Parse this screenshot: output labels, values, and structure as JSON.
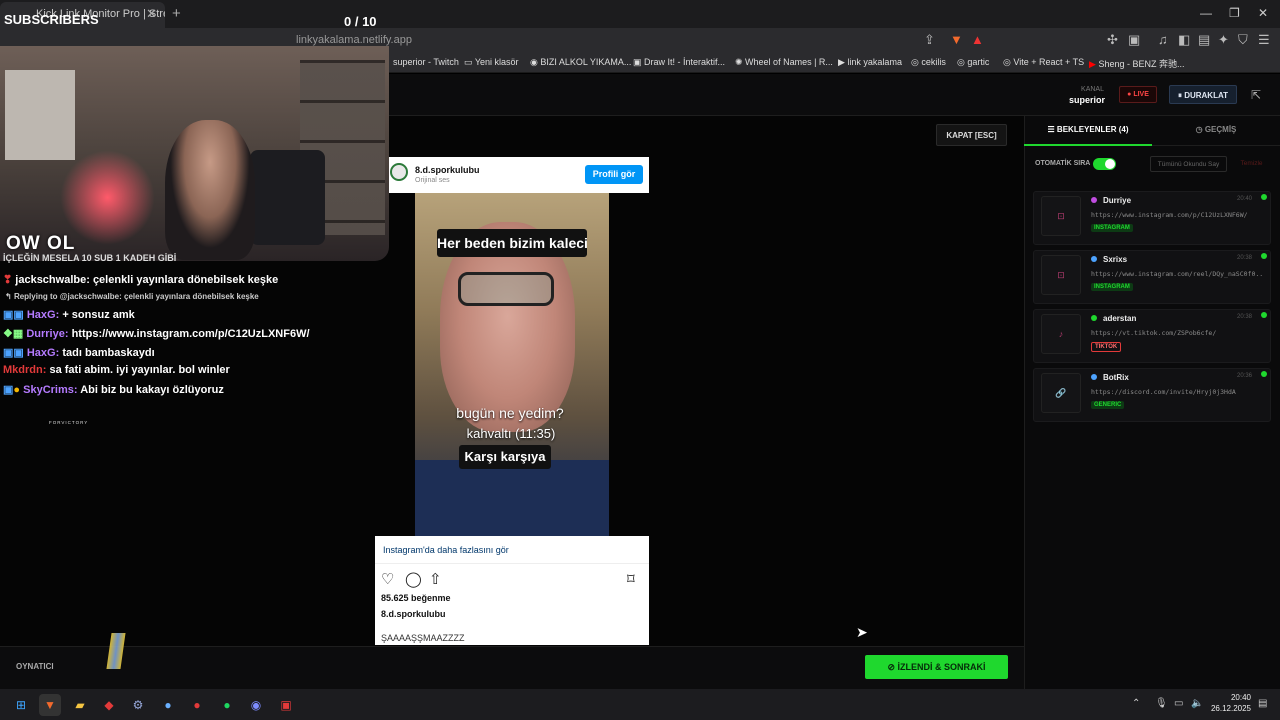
{
  "browser": {
    "tab_title": "Kick Link Monitor Pro | Stream",
    "url": "linkyakalama.netlify.app",
    "bookmarks": [
      "superior - Twitch",
      "Yeni klasör",
      "BIZI ALKOL YIKAMA...",
      "Draw It! - İnteraktif...",
      "Wheel of Names | R...",
      "link yakalama",
      "cekilis",
      "gartic",
      "Vite + React + TS",
      "Sheng - BENZ 奔驰..."
    ]
  },
  "overlay": {
    "subs_label": "SUBSCRIBERS",
    "subs_count": "0  / 10",
    "cam_logo": "OW OL",
    "partial_line": "İÇLEĞİN MESELA 10 SUB 1 KADEH GİBİ",
    "chat": [
      {
        "user": "jackschwalbe:",
        "text": "çelenkli yayınlara dönebilsek keşke",
        "color": "#ffffff"
      },
      {
        "reply": "Replying to @jackschwalbe: çelenkli yayınlara dönebilsek keşke"
      },
      {
        "user": "HaxG:",
        "text": "+ sonsuz amk",
        "color": "#b57bff"
      },
      {
        "user": "Durriye:",
        "text": "https://www.instagram.com/p/C12UzLXNF6W/",
        "color": "#b57bff"
      },
      {
        "user": "HaxG:",
        "text": "tadı bambaskaydı",
        "color": "#b57bff"
      },
      {
        "user": "Mkdrdn:",
        "text": "sa fati abim. iyi yayınlar. bol winler",
        "color": "#e23a3a"
      },
      {
        "user": "SkyCrims:",
        "text": "Abi biz bu kakayı özlüyoruz",
        "color": "#b57bff"
      }
    ],
    "sponsor": "FORVICTORY"
  },
  "header": {
    "kanal_label": "KANAL",
    "kanal_value": "superior",
    "live_label": "LIVE",
    "pause_label": "DURAKLAT"
  },
  "main": {
    "close_label": "KAPAT [ESC]",
    "embed": {
      "username": "8.d.sporkulubu",
      "subtitle": "Orijinal ses",
      "profile_button": "Profili gör",
      "caption_top": "Her beden bizim kaleci",
      "caption_mid": "bugün ne yedim?",
      "caption_time": "kahvaltı (11:35)",
      "caption_bottom": "Karşı karşıya",
      "more_link": "Instagram'da daha fazlasını gör",
      "likes": "85.625 beğenme",
      "username2": "8.d.sporkulubu",
      "post_caption": "ŞAAAAŞŞMAAZZZZ"
    }
  },
  "footer": {
    "player_label": "OYNATICI",
    "next_button": "İZLENDİ & SONRAKİ"
  },
  "panel": {
    "tab_waiting": "BEKLEYENLER (4)",
    "tab_history": "GEÇMİŞ",
    "auto_label": "OTOMATİK SIRA",
    "auto_on": true,
    "mark_all": "Tümünü Okundu Say",
    "clear": "Temizle",
    "items": [
      {
        "name": "Durriye",
        "time": "20:40",
        "url": "https://www.instagram.com/p/C12UzLXNF6W/",
        "badge": "INSTAGRAM",
        "dot": "#c04de0",
        "thumb": "⊡"
      },
      {
        "name": "Sxrixs",
        "time": "20:38",
        "url": "https://www.instagram.com/reel/DQy_naSC0f0...",
        "badge": "INSTAGRAM",
        "dot": "#4da3ff",
        "thumb": "⊡"
      },
      {
        "name": "aderstan",
        "time": "20:38",
        "url": "https://vt.tiktok.com/ZSPob6cfe/",
        "badge": "TIKTOK",
        "dot": "#1fd82e",
        "thumb": "♪"
      },
      {
        "name": "BotRix",
        "time": "20:36",
        "url": "https://discord.com/invite/Hryj0j3HdA",
        "badge": "GENERIC",
        "dot": "#4da3ff",
        "thumb": "🔗"
      }
    ]
  },
  "taskbar": {
    "time": "20:40",
    "date": "26.12.2025"
  }
}
